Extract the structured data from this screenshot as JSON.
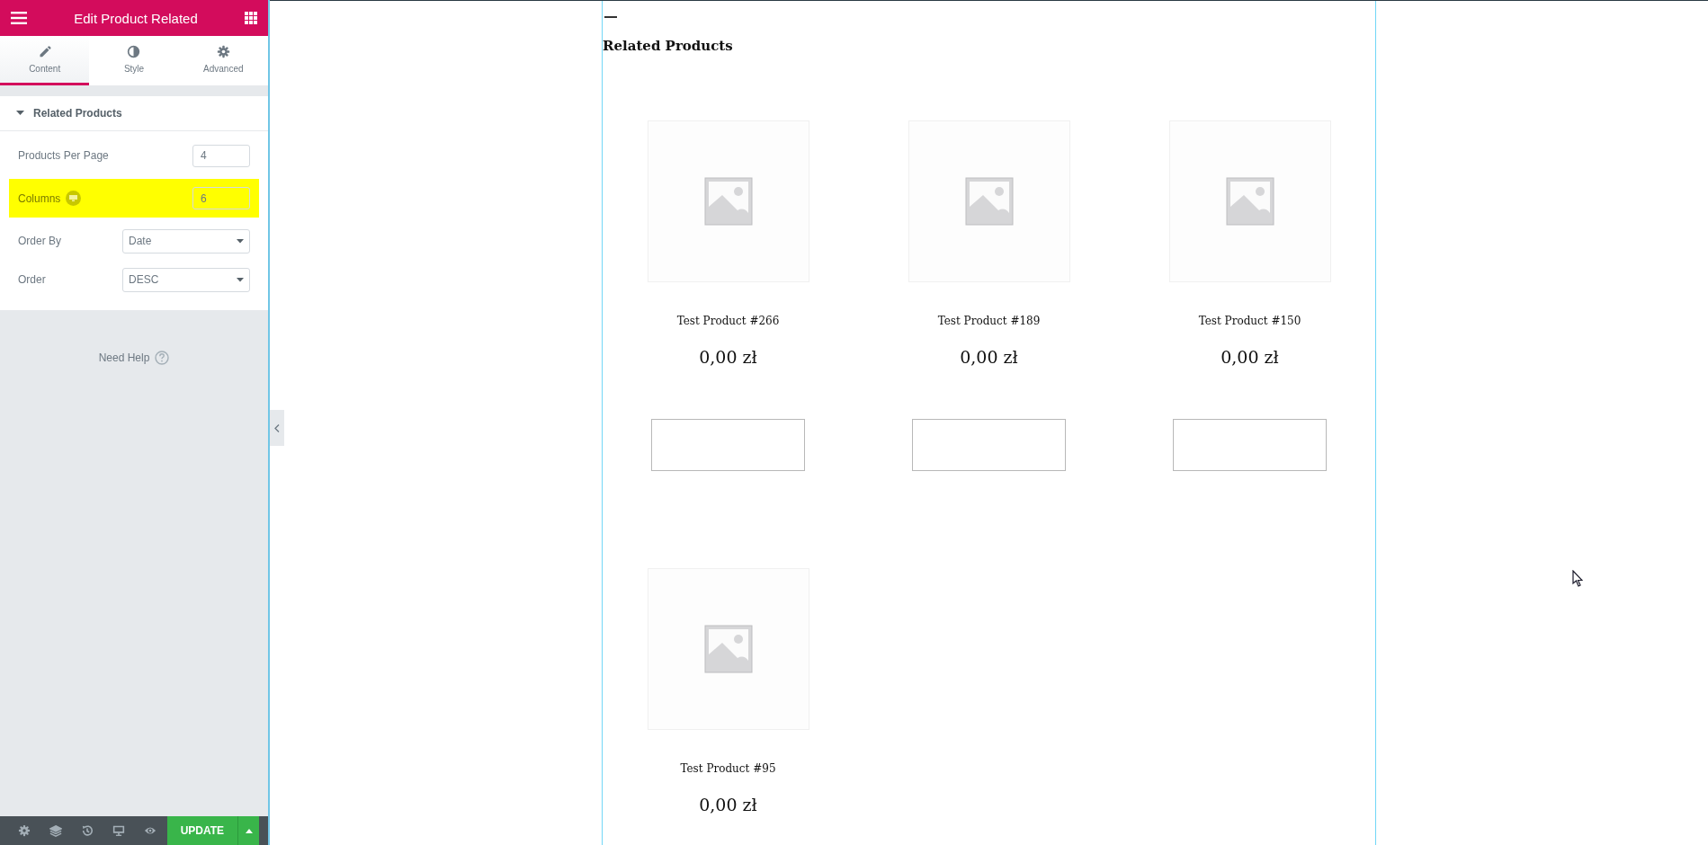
{
  "panel": {
    "title": "Edit Product Related",
    "tabs": [
      {
        "label": "Content",
        "selected": true
      },
      {
        "label": "Style",
        "selected": false
      },
      {
        "label": "Advanced",
        "selected": false
      }
    ],
    "section": {
      "title": "Related Products",
      "expanded": true
    },
    "controls": [
      {
        "label": "Products Per Page",
        "kind": "number",
        "value": "4",
        "highlighted": false,
        "responsive": false
      },
      {
        "label": "Columns",
        "kind": "number",
        "value": "6",
        "highlighted": true,
        "responsive": true
      },
      {
        "label": "Order By",
        "kind": "select",
        "value": "Date",
        "highlighted": false,
        "responsive": false
      },
      {
        "label": "Order",
        "kind": "select",
        "value": "DESC",
        "highlighted": false,
        "responsive": false
      }
    ],
    "help": "Need Help",
    "footer": {
      "update": "UPDATE"
    }
  },
  "preview": {
    "heading": "Related Products",
    "products": [
      {
        "name": "Test Product #266",
        "price": "0,00 zł",
        "button_shown": true
      },
      {
        "name": "Test Product #189",
        "price": "0,00 zł",
        "button_shown": true
      },
      {
        "name": "Test Product #150",
        "price": "0,00 zł",
        "button_shown": true
      },
      {
        "name": "Test Product #95",
        "price": "0,00 zł",
        "button_shown": false
      }
    ]
  }
}
